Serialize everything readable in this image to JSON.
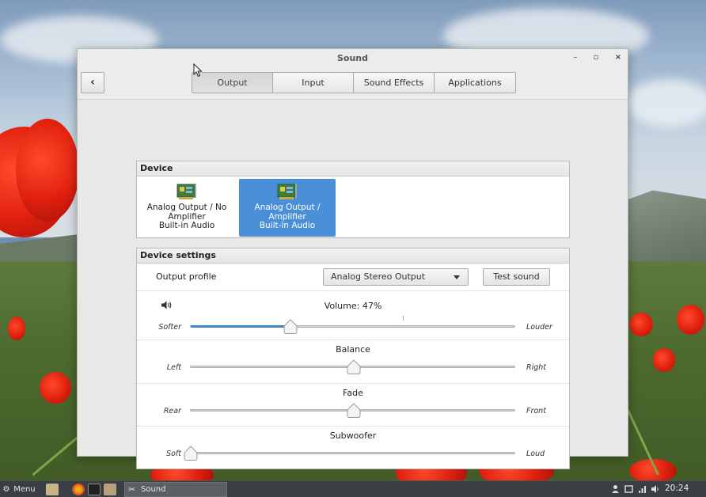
{
  "window": {
    "title": "Sound",
    "controls": {
      "minimize": "–",
      "maximize": "▫",
      "close": "×"
    },
    "back_icon": "chevron-left-icon",
    "back_label": "‹"
  },
  "tabs": [
    {
      "label": "Output",
      "active": true
    },
    {
      "label": "Input",
      "active": false
    },
    {
      "label": "Sound Effects",
      "active": false
    },
    {
      "label": "Applications",
      "active": false
    }
  ],
  "device_panel": {
    "header": "Device",
    "devices": [
      {
        "line1": "Analog Output / No",
        "line2": "Amplifier",
        "line3": "Built-in Audio",
        "selected": false,
        "icon": "sound-card-icon"
      },
      {
        "line1": "Analog Output /",
        "line2": "Amplifier",
        "line3": "Built-in Audio",
        "selected": true,
        "icon": "sound-card-icon"
      }
    ]
  },
  "settings_panel": {
    "header": "Device settings",
    "output_profile": {
      "label": "Output profile",
      "selected": "Analog Stereo Output",
      "test_button": "Test sound"
    },
    "volume": {
      "title": "Volume: 47%",
      "value_percent": 47,
      "left": "Softer",
      "right": "Louder",
      "icon": "speaker-icon"
    },
    "balance": {
      "title": "Balance",
      "left": "Left",
      "right": "Right",
      "position": 0.5
    },
    "fade": {
      "title": "Fade",
      "left": "Rear",
      "right": "Front",
      "position": 0.5
    },
    "subwoofer": {
      "title": "Subwoofer",
      "left": "Soft",
      "right": "Loud",
      "position": 0.0
    }
  },
  "taskbar": {
    "menu_label": "Menu",
    "task_label": "Sound",
    "clock": "20:24"
  },
  "colors": {
    "accent": "#4a90d9",
    "slider_fill": "#3f84c9",
    "taskbar": "#3b3f43"
  }
}
